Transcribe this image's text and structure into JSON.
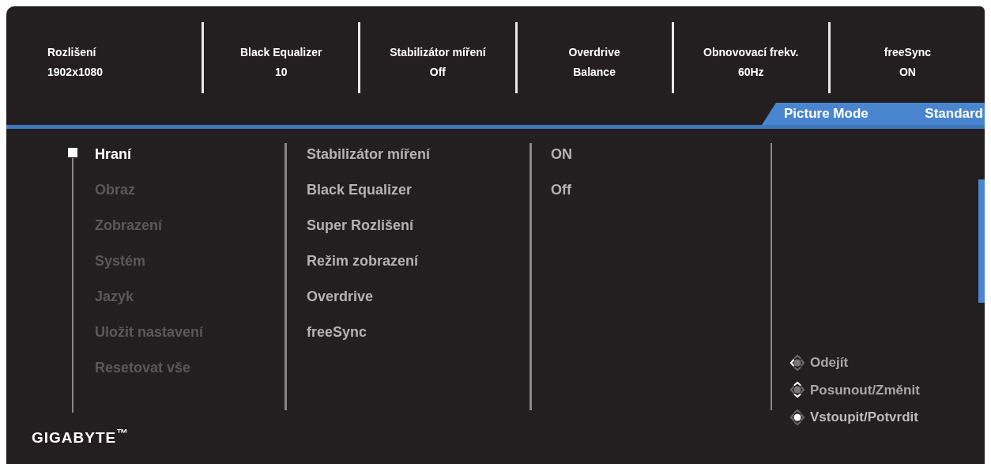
{
  "status_items": [
    {
      "label": "Rozlišení",
      "value": "1902x1080"
    },
    {
      "label": "Black Equalizer",
      "value": "10"
    },
    {
      "label": "Stabilizátor míření",
      "value": "Off"
    },
    {
      "label": "Overdrive",
      "value": "Balance"
    },
    {
      "label": "Obnovovací frekv.",
      "value": "60Hz"
    },
    {
      "label": "freeSync",
      "value": "ON"
    }
  ],
  "picture_mode": {
    "label": "Picture Mode",
    "value": "Standard"
  },
  "menu": [
    {
      "label": "Hraní",
      "selected": true
    },
    {
      "label": "Obraz",
      "selected": false
    },
    {
      "label": "Zobrazení",
      "selected": false
    },
    {
      "label": "Systém",
      "selected": false
    },
    {
      "label": "Jazyk",
      "selected": false
    },
    {
      "label": "Uložit nastavení",
      "selected": false
    },
    {
      "label": "Resetovat vše",
      "selected": false
    }
  ],
  "submenu": [
    "Stabilizátor míření",
    "Black Equalizer",
    "Super Rozlišení",
    "Režim zobrazení",
    "Overdrive",
    "freeSync"
  ],
  "options": [
    "ON",
    "Off"
  ],
  "brand": "GIGABYTE$^{™}$",
  "nav_hints": [
    {
      "kind": "exit",
      "label": "Odejít"
    },
    {
      "kind": "move",
      "label": "Posunout/Změnit"
    },
    {
      "kind": "enter",
      "label": "Vstoupit/Potvrdit"
    }
  ]
}
